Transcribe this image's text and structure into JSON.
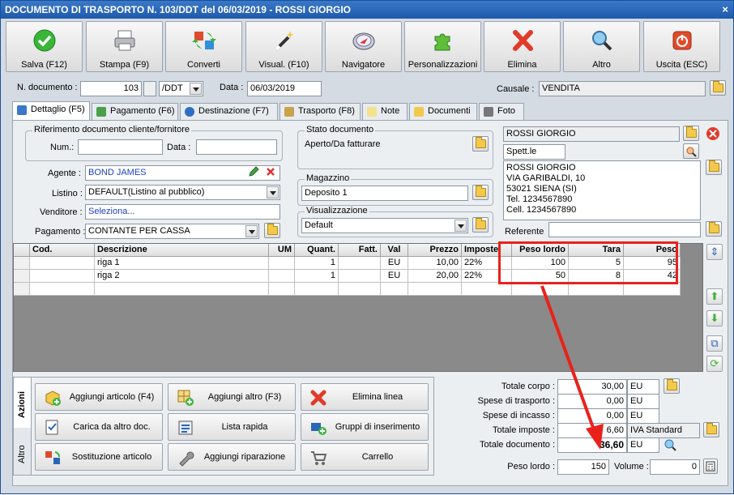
{
  "window": {
    "title": "DOCUMENTO DI TRASPORTO N. 103/DDT del 06/03/2019 - ROSSI GIORGIO",
    "close": "×"
  },
  "toolbar": [
    {
      "label": "Salva (F12)",
      "icon": "check-icon"
    },
    {
      "label": "Stampa (F9)",
      "icon": "printer-icon"
    },
    {
      "label": "Converti",
      "icon": "convert-icon"
    },
    {
      "label": "Visual. (F10)",
      "icon": "magic-wand-icon"
    },
    {
      "label": "Navigatore",
      "icon": "compass-icon"
    },
    {
      "label": "Personalizzazioni",
      "icon": "puzzle-icon"
    },
    {
      "label": "Elimina",
      "icon": "delete-x-icon"
    },
    {
      "label": "Altro",
      "icon": "magnifier-icon"
    },
    {
      "label": "Uscita (ESC)",
      "icon": "power-icon"
    }
  ],
  "header": {
    "ndoc_label": "N. documento :",
    "ndoc_value": "103",
    "ndoc_suffix": "/DDT",
    "data_label": "Data :",
    "data_value": "06/03/2019",
    "causale_label": "Causale :",
    "causale_value": "VENDITA"
  },
  "tabs": [
    {
      "label": "Dettaglio (F5)"
    },
    {
      "label": "Pagamento (F6)"
    },
    {
      "label": "Destinazione (F7)"
    },
    {
      "label": "Trasporto (F8)"
    },
    {
      "label": "Note"
    },
    {
      "label": "Documenti"
    },
    {
      "label": "Foto"
    }
  ],
  "rif": {
    "title": "Riferimento documento cliente/fornitore",
    "num_label": "Num.:",
    "num_value": "",
    "data_label": "Data :",
    "data_value": ""
  },
  "agente": {
    "label": "Agente :",
    "value": "BOND JAMES"
  },
  "listino": {
    "label": "Listino :",
    "value": "DEFAULT(Listino al pubblico)"
  },
  "venditore": {
    "label": "Venditore :",
    "value": "Seleziona..."
  },
  "pagamento": {
    "label": "Pagamento :",
    "value": "CONTANTE PER CASSA"
  },
  "stato": {
    "title": "Stato documento",
    "value": "Aperto/Da fatturare"
  },
  "magazzino": {
    "title": "Magazzino",
    "value": "Deposito 1"
  },
  "visualizzazione": {
    "title": "Visualizzazione",
    "value": "Default"
  },
  "cliente": {
    "name": "ROSSI GIORGIO",
    "title": "Spett.le",
    "address": [
      "ROSSI GIORGIO",
      "VIA GARIBALDI, 10",
      "53021 SIENA (SI)",
      "Tel. 1234567890",
      "Cell. 1234567890"
    ],
    "referente_label": "Referente",
    "referente_value": ""
  },
  "grid": {
    "headers": [
      "Cod.",
      "Descrizione",
      "UM",
      "Quant.",
      "Fatt.",
      "Val",
      "Prezzo",
      "Imposte",
      "Peso lordo",
      "Tara",
      "Peso"
    ],
    "rows": [
      [
        "",
        "riga 1",
        "",
        "1",
        "",
        "EU",
        "10,00",
        "22%",
        "100",
        "5",
        "95"
      ],
      [
        "",
        "riga 2",
        "",
        "1",
        "",
        "EU",
        "20,00",
        "22%",
        "50",
        "8",
        "42"
      ],
      [
        "",
        "",
        "",
        "",
        "",
        "",
        "",
        "",
        "",
        "",
        ""
      ]
    ]
  },
  "actions": {
    "vtab_azioni": "Azioni",
    "vtab_altro": "Altro",
    "buttons": [
      {
        "label": "Aggiungi articolo (F4)"
      },
      {
        "label": "Aggiungi altro (F3)"
      },
      {
        "label": "Elimina linea"
      },
      {
        "label": "Carica da altro doc."
      },
      {
        "label": "Lista rapida"
      },
      {
        "label": "Gruppi di inserimento"
      },
      {
        "label": "Sostituzione articolo"
      },
      {
        "label": "Aggiungi riparazione"
      },
      {
        "label": "Carrello"
      }
    ]
  },
  "totals": {
    "corpo_label": "Totale corpo :",
    "corpo_value": "30,00",
    "corpo_cur": "EU",
    "trasporto_label": "Spese di trasporto :",
    "trasporto_value": "0,00",
    "trasporto_cur": "EU",
    "incasso_label": "Spese di incasso :",
    "incasso_value": "0,00",
    "incasso_cur": "EU",
    "imposte_label": "Totale imposte :",
    "imposte_value": "6,60",
    "imposte_desc": "IVA Standard",
    "documento_label": "Totale documento :",
    "documento_value": "36,60",
    "documento_cur": "EU",
    "peso_label": "Peso lordo :",
    "peso_value": "150",
    "volume_label": "Volume :",
    "volume_value": "0"
  },
  "colors": {
    "highlight": "#e8221b",
    "title_bg": "#2a66b8",
    "agent_text": "#1a3fc4"
  }
}
